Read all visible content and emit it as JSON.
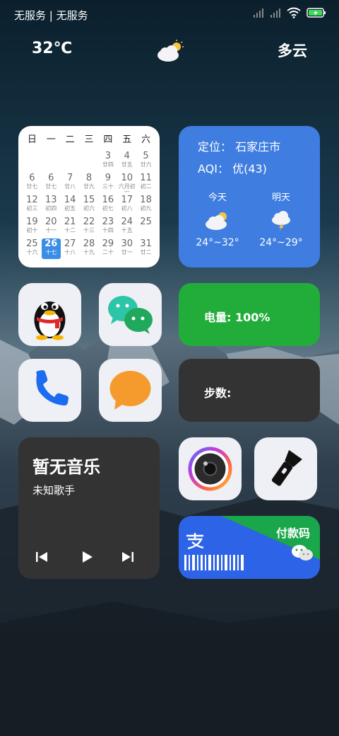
{
  "status_bar": {
    "carrier": "无服务 | 无服务",
    "battery_icon": "battery-charging-icon",
    "wifi_icon": "wifi-icon",
    "signal_icon": "signal-icon"
  },
  "weather_header": {
    "temperature": "32℃",
    "condition": "多云",
    "icon": "partly-cloudy-icon"
  },
  "calendar": {
    "weekdays": [
      "日",
      "一",
      "二",
      "三",
      "四",
      "五",
      "六"
    ],
    "weeks": [
      [
        null,
        null,
        null,
        null,
        {
          "d": "3",
          "l": "廿四"
        },
        {
          "d": "4",
          "l": "廿五"
        },
        {
          "d": "5",
          "l": "廿六"
        }
      ],
      [
        {
          "d": "6",
          "l": "廿七"
        },
        {
          "d": "6",
          "l": "廿七"
        },
        {
          "d": "7",
          "l": "廿八"
        },
        {
          "d": "8",
          "l": "廿九"
        },
        {
          "d": "9",
          "l": "三十"
        },
        {
          "d": "10",
          "l": "六月初一"
        },
        {
          "d": "11",
          "l": "初二"
        }
      ],
      [
        {
          "d": "12",
          "l": "初三"
        },
        {
          "d": "13",
          "l": "初四"
        },
        {
          "d": "14",
          "l": "初五"
        },
        {
          "d": "15",
          "l": "初六"
        },
        {
          "d": "16",
          "l": "初七"
        },
        {
          "d": "17",
          "l": "初八"
        },
        {
          "d": "18",
          "l": "初九"
        }
      ],
      [
        {
          "d": "19",
          "l": "初十"
        },
        {
          "d": "20",
          "l": "十一"
        },
        {
          "d": "21",
          "l": "十二"
        },
        {
          "d": "22",
          "l": "十三"
        },
        {
          "d": "23",
          "l": "十四"
        },
        {
          "d": "24",
          "l": "十五"
        },
        {
          "d": "25",
          "l": ""
        }
      ],
      [
        {
          "d": "25",
          "l": "十六"
        },
        {
          "d": "26",
          "l": "十七",
          "today": true
        },
        {
          "d": "27",
          "l": "十八"
        },
        {
          "d": "28",
          "l": "十九"
        },
        {
          "d": "29",
          "l": "二十"
        },
        {
          "d": "30",
          "l": "廿一"
        },
        {
          "d": "31",
          "l": "廿二"
        }
      ]
    ]
  },
  "weather_card": {
    "location_label": "定位：",
    "location": "石家庄市",
    "aqi_label": "AQI：",
    "aqi_value": "优(43)",
    "today_label": "今天",
    "today_range": "24°~32°",
    "today_icon": "partly-cloudy-icon",
    "tomorrow_label": "明天",
    "tomorrow_range": "24°~29°",
    "tomorrow_icon": "thunderstorm-icon",
    "color": "#3f7ee0"
  },
  "apps": {
    "qq_icon": "qq-penguin-icon",
    "wechat_icon": "wechat-icon",
    "phone_icon": "phone-icon",
    "messages_icon": "message-bubble-icon",
    "camera_icon": "camera-icon",
    "flashlight_icon": "flashlight-icon"
  },
  "battery_widget": {
    "text": "电量: 100%",
    "color": "#22ad3a"
  },
  "steps_widget": {
    "text": "步数:"
  },
  "music_widget": {
    "title": "暂无音乐",
    "artist": "未知歌手",
    "prev_icon": "skip-previous-icon",
    "play_icon": "play-icon",
    "next_icon": "skip-next-icon"
  },
  "pay_widget": {
    "text": "付款码",
    "alipay_icon": "alipay-icon",
    "wechat_icon": "wechat-icon"
  }
}
